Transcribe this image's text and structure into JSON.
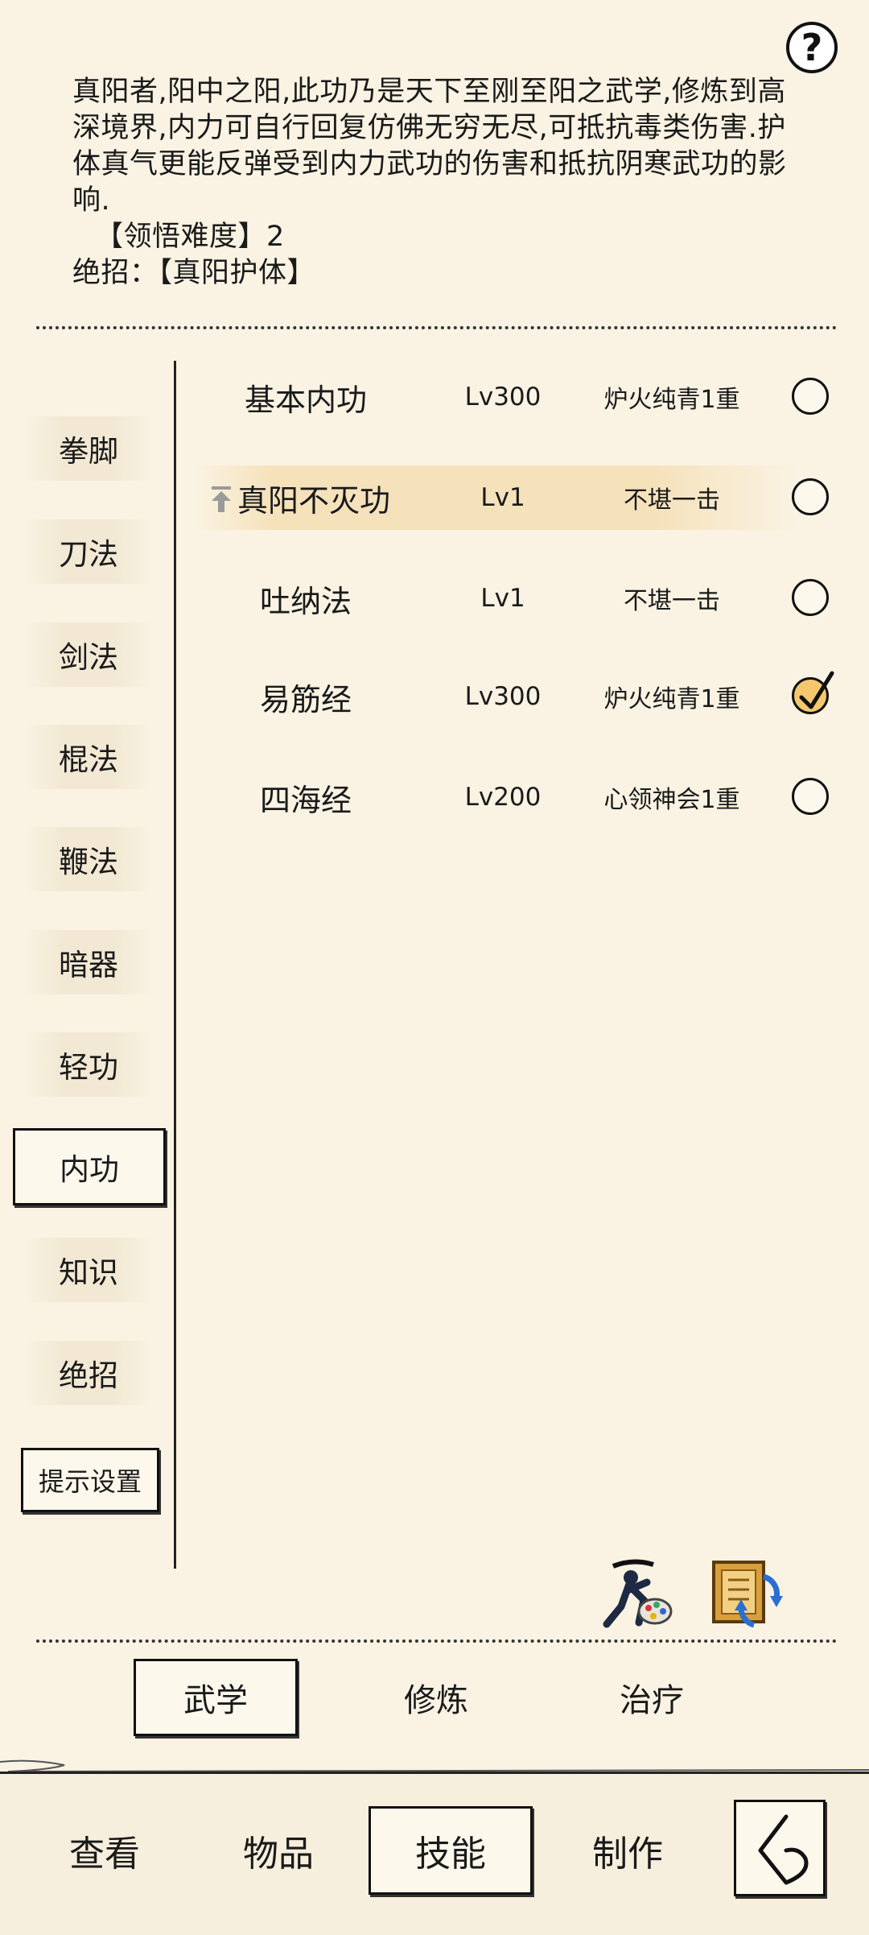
{
  "description": {
    "body": "真阳者,阳中之阳,此功乃是天下至刚至阳之武学,修炼到高深境界,内力可自行回复仿佛无穷无尽,可抵抗毒类伤害.护体真气更能反弹受到内力武功的伤害和抵抗阴寒武功的影响.",
    "difficulty": "【领悟难度】2",
    "move": "绝招：【真阳护体】"
  },
  "help": {
    "label": "?"
  },
  "categories": [
    {
      "label": "拳脚"
    },
    {
      "label": "刀法"
    },
    {
      "label": "剑法"
    },
    {
      "label": "棍法"
    },
    {
      "label": "鞭法"
    },
    {
      "label": "暗器"
    },
    {
      "label": "轻功"
    },
    {
      "label": "内功"
    },
    {
      "label": "知识"
    },
    {
      "label": "绝招"
    }
  ],
  "active_category": "内功",
  "hint_settings": {
    "label": "提示设置"
  },
  "skills": [
    {
      "name": "基本内功",
      "level": "Lv300",
      "rank": "炉火纯青1重",
      "checked": false,
      "highlight": false,
      "upgrade_icon": false
    },
    {
      "name": "真阳不灭功",
      "level": "Lv1",
      "rank": "不堪一击",
      "checked": false,
      "highlight": true,
      "upgrade_icon": true
    },
    {
      "name": "吐纳法",
      "level": "Lv1",
      "rank": "不堪一击",
      "checked": false,
      "highlight": false,
      "upgrade_icon": false
    },
    {
      "name": "易筋经",
      "level": "Lv300",
      "rank": "炉火纯青1重",
      "checked": true,
      "highlight": false,
      "upgrade_icon": false
    },
    {
      "name": "四海经",
      "level": "Lv200",
      "rank": "心领神会1重",
      "checked": false,
      "highlight": false,
      "upgrade_icon": false
    }
  ],
  "tools": [
    {
      "icon": "warrior-palette-icon"
    },
    {
      "icon": "book-refresh-icon"
    }
  ],
  "tabs": [
    {
      "label": "武学",
      "active": true
    },
    {
      "label": "修炼",
      "active": false
    },
    {
      "label": "治疗",
      "active": false
    }
  ],
  "nav": [
    {
      "label": "查看",
      "active": false
    },
    {
      "label": "物品",
      "active": false
    },
    {
      "label": "技能",
      "active": true
    },
    {
      "label": "制作",
      "active": false
    }
  ],
  "back": {
    "icon": "back-arrow-icon"
  },
  "colors": {
    "background": "#faf3e3",
    "highlight": "#f5e1b9",
    "check_fill": "#f5c86e",
    "ink": "#111111"
  }
}
